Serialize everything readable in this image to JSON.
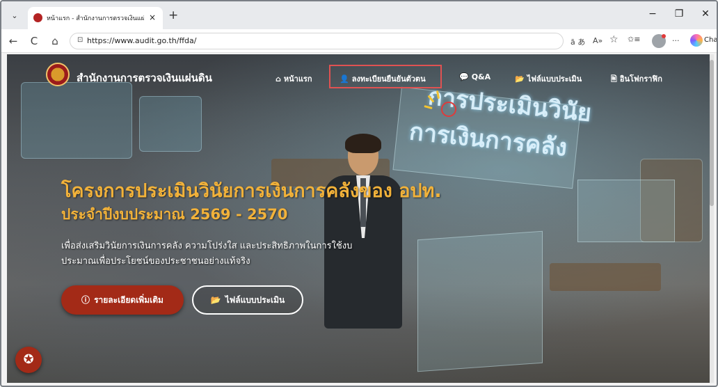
{
  "browser": {
    "tab": {
      "title": "หน้าแรก - สำนักงานการตรวจเงินแผ่นดิน",
      "close": "×"
    },
    "new_tab": "+",
    "controls": {
      "minimize": "−",
      "restore": "❐",
      "close": "✕"
    },
    "nav": {
      "back": "←",
      "reload": "C",
      "home": "⌂"
    },
    "address": {
      "url": "https://www.audit.go.th/ffda/"
    },
    "toolbar_icons": {
      "read_aloud": "A»",
      "favorite": "☆",
      "favorites": "✩≡",
      "more": "···"
    },
    "copilot_label": "Chat"
  },
  "site": {
    "name": "สำนักงานการตรวจเงินแผ่นดิน",
    "nav": [
      {
        "icon": "⌂",
        "label": "หน้าแรก"
      },
      {
        "icon": "👤",
        "label": "ลงทะเบียนยืนยันตัวตน"
      },
      {
        "icon": "💬",
        "label": "Q&A"
      },
      {
        "icon": "📂",
        "label": "ไฟล์แบบประเมิน"
      },
      {
        "icon": "🖹",
        "label": "อินโฟกราฟิก"
      }
    ],
    "hero": {
      "glass_line1": "การประเมินวินัย",
      "glass_line2": "การเงินการคลัง",
      "title": "โครงการประเมินวินัยการเงินการคลังของ อปท.",
      "subtitle": "ประจำปีงบประมาณ 2569 - 2570",
      "desc_line1": "เพื่อส่งเสริมวินัยการเงินการคลัง ความโปร่งใส และประสิทธิภาพในการใช้งบ",
      "desc_line2": "ประมาณเพื่อประโยชน์ของประชาชนอย่างแท้จริง",
      "btn_details": "รายละเอียดเพิ่มเติม",
      "btn_files": "ไฟล์แบบประเมิน"
    },
    "accessibility_icon": "✪"
  },
  "colors": {
    "accent": "#a32a17",
    "heading": "#f2b23a",
    "highlight": "#e05252"
  }
}
